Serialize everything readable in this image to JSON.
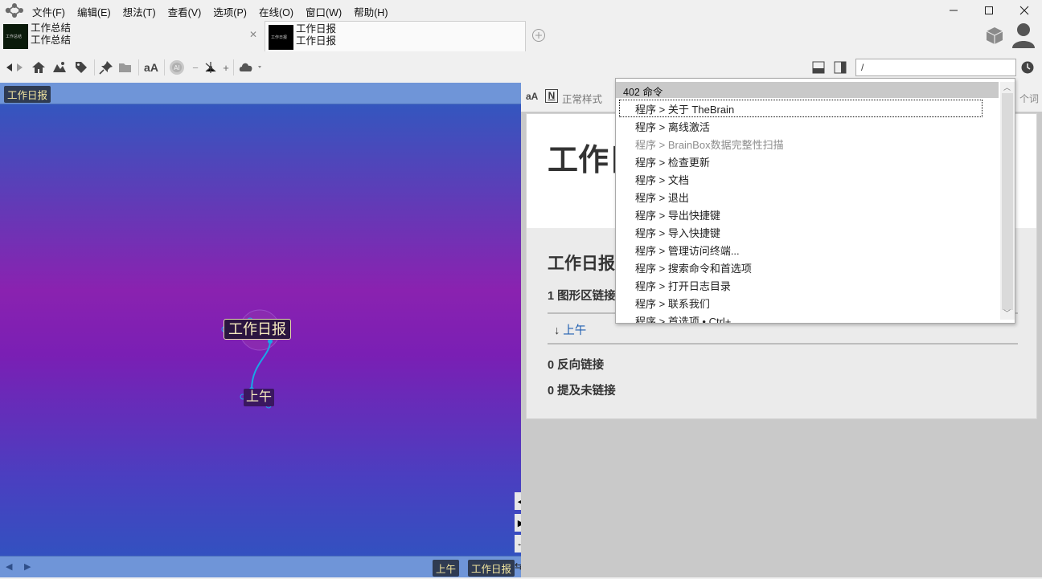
{
  "menubar": {
    "items": [
      "文件(F)",
      "编辑(E)",
      "想法(T)",
      "查看(V)",
      "选项(P)",
      "在线(O)",
      "窗口(W)",
      "帮助(H)"
    ]
  },
  "tabs": [
    {
      "line1": "工作总结",
      "line2": "工作总结",
      "thumb_text": "工作总结"
    },
    {
      "line1": "工作日报",
      "line2": "工作日报",
      "thumb_text": "工作日报"
    }
  ],
  "toolbar": {
    "search_value": "/"
  },
  "plex": {
    "header_crumb": "工作日报",
    "central_node": "工作日报",
    "child_node": "上午",
    "footer_crumbs": [
      "上午",
      "工作日报"
    ]
  },
  "notes": {
    "style_value": "正常样式",
    "word_count_label": "个词",
    "title": "工作日报",
    "subtitle": "工作日报",
    "links_count_label": "1 图形区链接",
    "link_item": "上午",
    "backlinks_label": "0 反向链接",
    "unlinked_label": "0 提及未链接"
  },
  "popup": {
    "header": "402 命令",
    "items": [
      {
        "label": "程序 > 关于 TheBrain",
        "state": "selected"
      },
      {
        "label": "程序 > 离线激活",
        "state": "normal"
      },
      {
        "label": "程序 > BrainBox数据完整性扫描",
        "state": "disabled"
      },
      {
        "label": "程序 > 检查更新",
        "state": "normal"
      },
      {
        "label": "程序 > 文档",
        "state": "normal"
      },
      {
        "label": "程序 > 退出",
        "state": "normal"
      },
      {
        "label": "程序 > 导出快捷键",
        "state": "normal"
      },
      {
        "label": "程序 > 导入快捷键",
        "state": "normal"
      },
      {
        "label": "程序 > 管理访问终端...",
        "state": "normal"
      },
      {
        "label": "程序 > 搜索命令和首选项",
        "state": "normal"
      },
      {
        "label": "程序 > 打开日志目录",
        "state": "normal"
      },
      {
        "label": "程序 > 联系我们",
        "state": "normal"
      },
      {
        "label": "程序 > 首选项    • Ctrl+,",
        "state": "normal"
      }
    ]
  },
  "colors": {
    "accent_link": "#1f5fb0",
    "node_text": "#f8edc0",
    "plex_header": "#6f95d8"
  }
}
